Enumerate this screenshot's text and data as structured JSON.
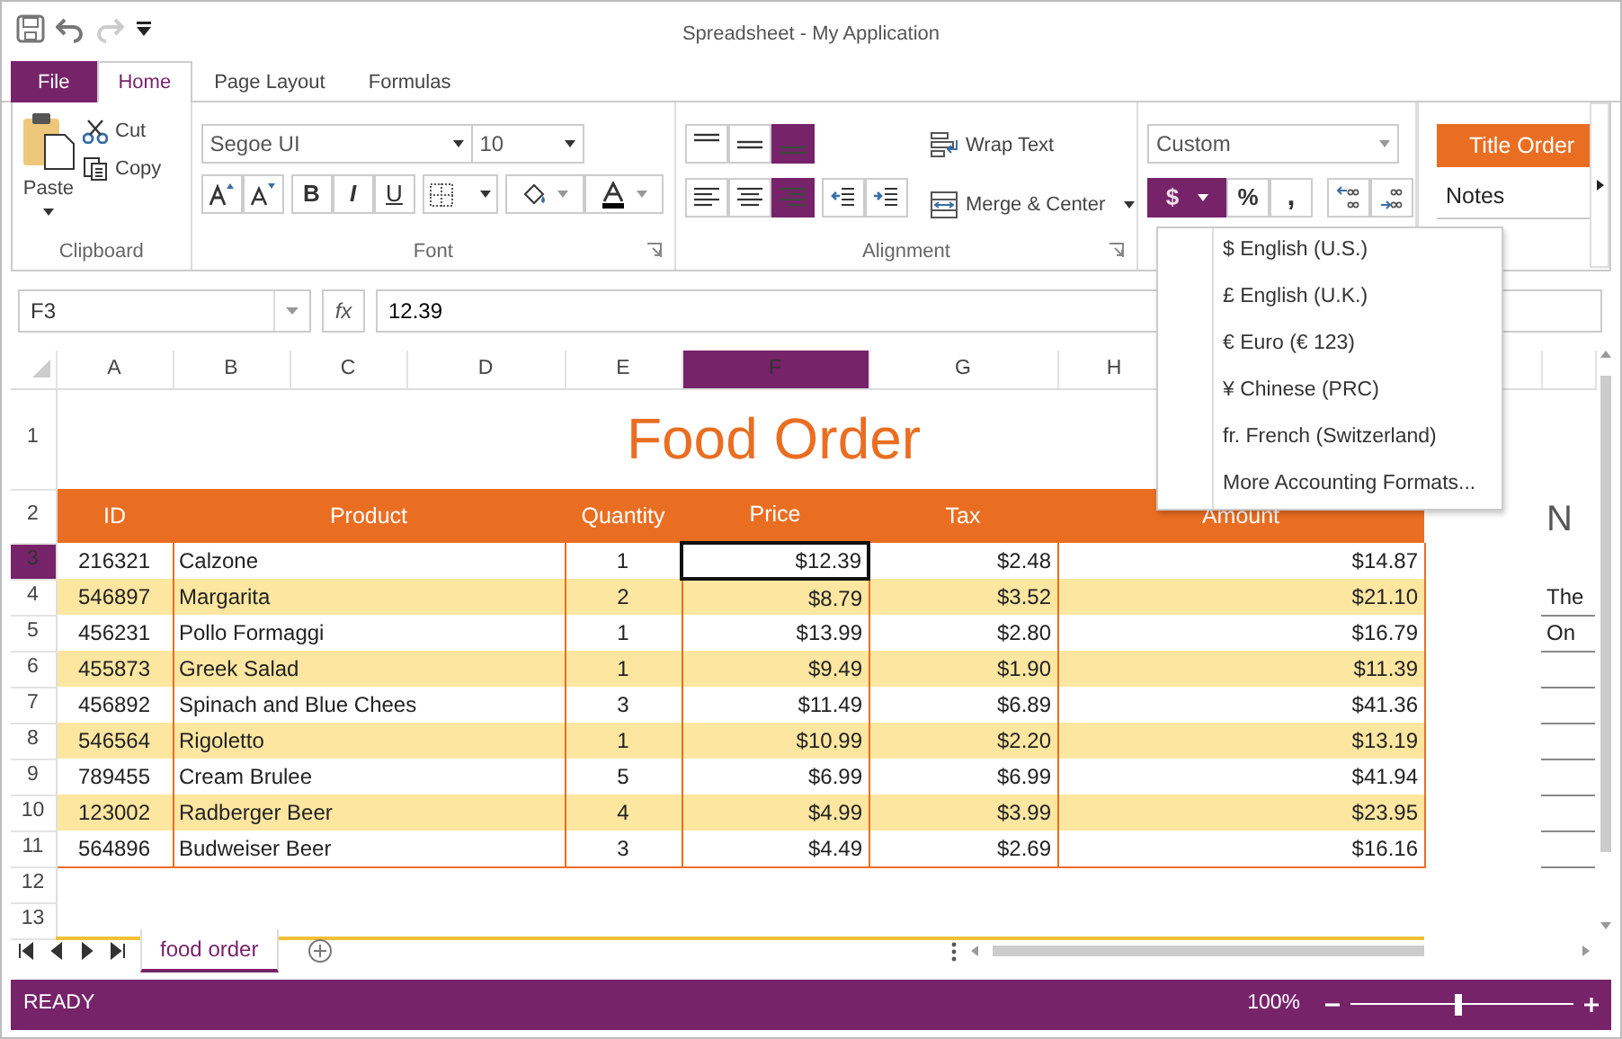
{
  "window": {
    "title": "Spreadsheet - My Application"
  },
  "quick_access": [
    {
      "kind": "save",
      "disabled": false
    },
    {
      "kind": "undo",
      "disabled": false
    },
    {
      "kind": "redo",
      "disabled": true
    },
    {
      "kind": "customize",
      "disabled": false
    }
  ],
  "tabs": [
    {
      "label": "File",
      "kind": "file",
      "selected": false
    },
    {
      "label": "Home",
      "kind": "tab",
      "selected": true
    },
    {
      "label": "Page Layout",
      "kind": "tab",
      "selected": false
    },
    {
      "label": "Formulas",
      "kind": "tab",
      "selected": false
    }
  ],
  "ribbon": {
    "clipboard": {
      "title": "Clipboard",
      "paste": "Paste",
      "cut": "Cut",
      "copy": "Copy"
    },
    "font": {
      "title": "Font",
      "font_name": "Segoe UI",
      "font_size": "10",
      "bold": "B",
      "italic": "I",
      "underline": "U"
    },
    "alignment": {
      "title": "Alignment",
      "vertical": [
        {
          "kind": "top",
          "selected": false
        },
        {
          "kind": "middle",
          "selected": false
        },
        {
          "kind": "bottom",
          "selected": true
        }
      ],
      "horizontal": [
        {
          "kind": "left",
          "selected": false
        },
        {
          "kind": "center",
          "selected": false
        },
        {
          "kind": "right",
          "selected": true
        }
      ],
      "wrap_text": "Wrap Text",
      "merge_center": "Merge & Center"
    },
    "number": {
      "format": "Custom",
      "accounting_symbol": "$",
      "accounting_expanded": true,
      "percent_symbol": "%",
      "comma_symbol": ","
    },
    "styles": [
      {
        "label": "Title Order",
        "kind": "title"
      },
      {
        "label": "Notes",
        "kind": "notes"
      }
    ]
  },
  "formula_bar": {
    "name_box": "F3",
    "function_label": "fx",
    "value": "12.39"
  },
  "grid": {
    "columns": [
      {
        "label": "A",
        "selected": false
      },
      {
        "label": "B",
        "selected": false
      },
      {
        "label": "C",
        "selected": false
      },
      {
        "label": "D",
        "selected": false
      },
      {
        "label": "E",
        "selected": false
      },
      {
        "label": "F",
        "selected": true
      },
      {
        "label": "G",
        "selected": false
      },
      {
        "label": "H",
        "selected": false
      }
    ],
    "row_numbers": [
      {
        "label": "1",
        "selected": false
      },
      {
        "label": "2",
        "selected": false
      },
      {
        "label": "3",
        "selected": true
      },
      {
        "label": "4",
        "selected": false
      },
      {
        "label": "5",
        "selected": false
      },
      {
        "label": "6",
        "selected": false
      },
      {
        "label": "7",
        "selected": false
      },
      {
        "label": "8",
        "selected": false
      },
      {
        "label": "9",
        "selected": false
      },
      {
        "label": "10",
        "selected": false
      },
      {
        "label": "11",
        "selected": false
      },
      {
        "label": "12",
        "selected": false
      },
      {
        "label": "13",
        "selected": false
      }
    ]
  },
  "sheet": {
    "title": "Food Order",
    "headers": [
      "ID",
      "Product",
      "Quantity",
      "Price",
      "Tax",
      "Amount"
    ],
    "rows": [
      {
        "cells": [
          {
            "text": "216321",
            "selected": false
          },
          {
            "text": "Calzone",
            "selected": false
          },
          {
            "text": "1",
            "selected": false
          },
          {
            "text": "$12.39",
            "selected": true
          },
          {
            "text": "$2.48",
            "selected": false
          },
          {
            "text": "$14.87",
            "selected": false
          }
        ]
      },
      {
        "cells": [
          {
            "text": "546897",
            "selected": false
          },
          {
            "text": "Margarita",
            "selected": false
          },
          {
            "text": "2",
            "selected": false
          },
          {
            "text": "$8.79",
            "selected": false
          },
          {
            "text": "$3.52",
            "selected": false
          },
          {
            "text": "$21.10",
            "selected": false
          }
        ]
      },
      {
        "cells": [
          {
            "text": "456231",
            "selected": false
          },
          {
            "text": "Pollo Formaggi",
            "selected": false
          },
          {
            "text": "1",
            "selected": false
          },
          {
            "text": "$13.99",
            "selected": false
          },
          {
            "text": "$2.80",
            "selected": false
          },
          {
            "text": "$16.79",
            "selected": false
          }
        ]
      },
      {
        "cells": [
          {
            "text": "455873",
            "selected": false
          },
          {
            "text": "Greek Salad",
            "selected": false
          },
          {
            "text": "1",
            "selected": false
          },
          {
            "text": "$9.49",
            "selected": false
          },
          {
            "text": "$1.90",
            "selected": false
          },
          {
            "text": "$11.39",
            "selected": false
          }
        ]
      },
      {
        "cells": [
          {
            "text": "456892",
            "selected": false
          },
          {
            "text": "Spinach and Blue Chees",
            "selected": false
          },
          {
            "text": "3",
            "selected": false
          },
          {
            "text": "$11.49",
            "selected": false
          },
          {
            "text": "$6.89",
            "selected": false
          },
          {
            "text": "$41.36",
            "selected": false
          }
        ]
      },
      {
        "cells": [
          {
            "text": "546564",
            "selected": false
          },
          {
            "text": "Rigoletto",
            "selected": false
          },
          {
            "text": "1",
            "selected": false
          },
          {
            "text": "$10.99",
            "selected": false
          },
          {
            "text": "$2.20",
            "selected": false
          },
          {
            "text": "$13.19",
            "selected": false
          }
        ]
      },
      {
        "cells": [
          {
            "text": "789455",
            "selected": false
          },
          {
            "text": "Cream Brulee",
            "selected": false
          },
          {
            "text": "5",
            "selected": false
          },
          {
            "text": "$6.99",
            "selected": false
          },
          {
            "text": "$6.99",
            "selected": false
          },
          {
            "text": "$41.94",
            "selected": false
          }
        ]
      },
      {
        "cells": [
          {
            "text": "123002",
            "selected": false
          },
          {
            "text": "Radberger Beer",
            "selected": false
          },
          {
            "text": "4",
            "selected": false
          },
          {
            "text": "$4.99",
            "selected": false
          },
          {
            "text": "$3.99",
            "selected": false
          },
          {
            "text": "$23.95",
            "selected": false
          }
        ]
      },
      {
        "cells": [
          {
            "text": "564896",
            "selected": false
          },
          {
            "text": "Budweiser Beer",
            "selected": false
          },
          {
            "text": "3",
            "selected": false
          },
          {
            "text": "$4.49",
            "selected": false
          },
          {
            "text": "$2.69",
            "selected": false
          },
          {
            "text": "$16.16",
            "selected": false
          }
        ]
      }
    ],
    "notes": {
      "heading": "N",
      "lines": [
        "The",
        "On"
      ]
    }
  },
  "accounting_menu": {
    "items": [
      "$ English (U.S.)",
      "£ English (U.K.)",
      "€ Euro (€ 123)",
      "¥ Chinese (PRC)",
      "fr. French (Switzerland)",
      "More Accounting Formats..."
    ]
  },
  "sheet_tabs": [
    {
      "label": "food order",
      "selected": true
    }
  ],
  "status_bar": {
    "status": "READY",
    "zoom": "100%",
    "zoom_slider": {
      "level": 0.48
    }
  }
}
